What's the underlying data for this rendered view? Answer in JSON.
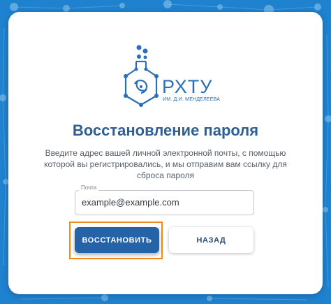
{
  "logo": {
    "name": "РХТУ",
    "subtitle": "ИМ. Д.И. МЕНДЕЛЕЕВА"
  },
  "page": {
    "title": "Восстановление пароля",
    "description": "Введите адрес вашей личной электронной почты, с помощью которой вы регистрировались, и мы отправим вам ссылку для сброса пароля"
  },
  "form": {
    "email_label": "Почта",
    "email_value": "example@example.com"
  },
  "buttons": {
    "restore_label": "ВОССТАНОВИТЬ",
    "back_label": "НАЗАД"
  },
  "colors": {
    "background": "#1f82cf",
    "brand": "#2a6fb7",
    "primary_button": "#2563a8",
    "highlight": "#f08a1c"
  }
}
